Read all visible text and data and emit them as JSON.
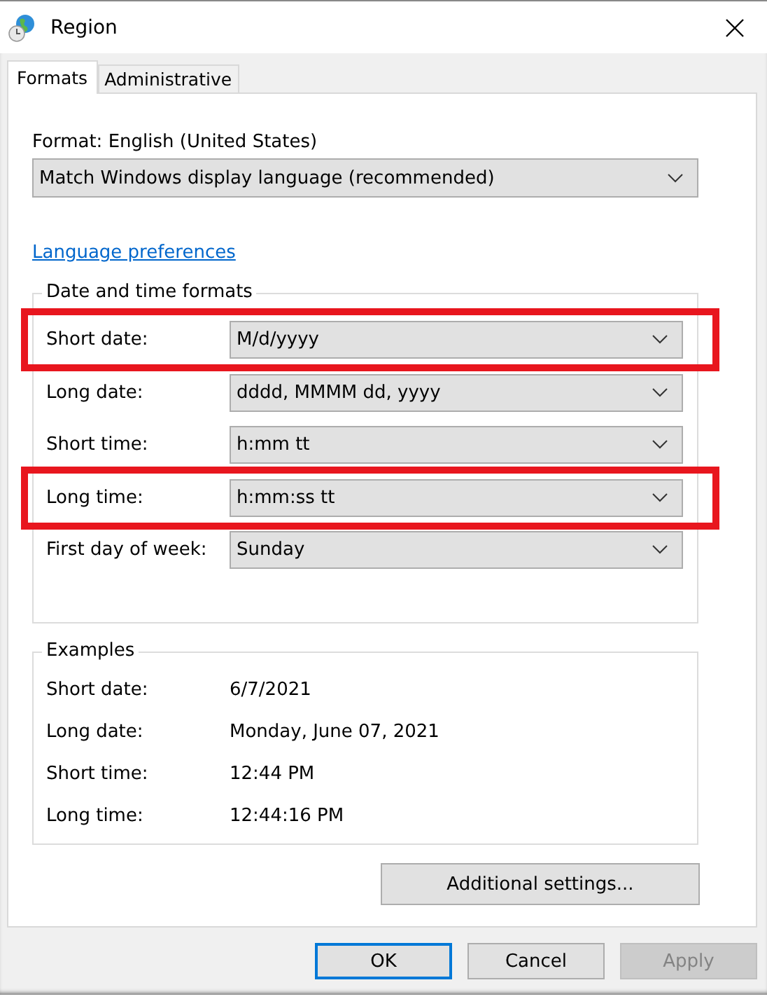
{
  "window": {
    "title": "Region"
  },
  "tabs": [
    {
      "label": "Formats",
      "selected": true
    },
    {
      "label": "Administrative",
      "selected": false
    }
  ],
  "format": {
    "label": "Format: English (United States)",
    "value": "Match Windows display language (recommended)"
  },
  "link": "Language preferences",
  "date_time_formats": {
    "title": "Date and time formats",
    "rows": [
      {
        "label": "Short date:",
        "value": "M/d/yyyy",
        "highlighted": true
      },
      {
        "label": "Long date:",
        "value": "dddd, MMMM dd, yyyy",
        "highlighted": false
      },
      {
        "label": "Short time:",
        "value": "h:mm tt",
        "highlighted": false
      },
      {
        "label": "Long time:",
        "value": "h:mm:ss tt",
        "highlighted": true
      },
      {
        "label": "First day of week:",
        "value": "Sunday",
        "highlighted": false
      }
    ]
  },
  "examples": {
    "title": "Examples",
    "rows": [
      {
        "label": "Short date:",
        "value": "6/7/2021"
      },
      {
        "label": "Long date:",
        "value": "Monday, June 07, 2021"
      },
      {
        "label": "Short time:",
        "value": "12:44 PM"
      },
      {
        "label": "Long time:",
        "value": "12:44:16 PM"
      }
    ]
  },
  "additional_button": "Additional settings...",
  "buttons": [
    {
      "label": "OK",
      "kind": "default",
      "disabled": false
    },
    {
      "label": "Cancel",
      "kind": "normal",
      "disabled": false
    },
    {
      "label": "Apply",
      "kind": "normal",
      "disabled": true
    }
  ]
}
